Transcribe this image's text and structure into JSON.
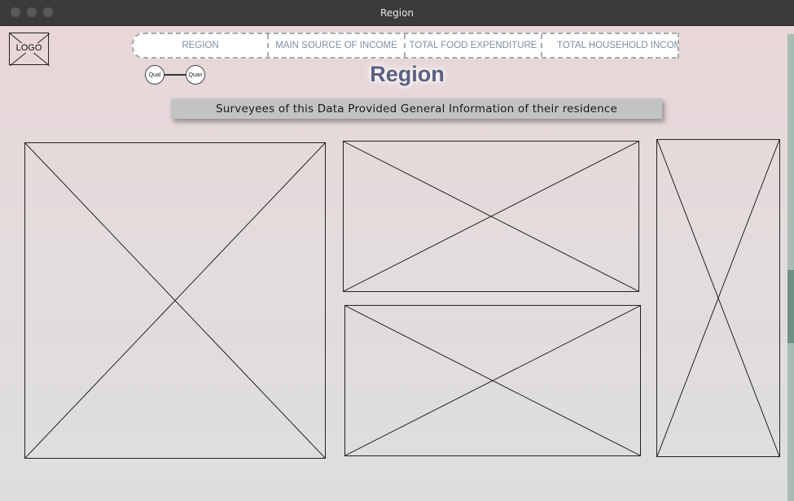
{
  "window": {
    "title": "Region"
  },
  "logo": {
    "label": "LOGO"
  },
  "tabs": [
    {
      "label": "REGION"
    },
    {
      "label": "MAIN SOURCE OF INCOME"
    },
    {
      "label": "TOTAL FOOD EXPENDITURE"
    },
    {
      "label": "TOTAL HOUSEHOLD INCOME"
    }
  ],
  "toggle": {
    "left_label": "Qual",
    "right_label": "Quan"
  },
  "page": {
    "title": "Region",
    "subtitle": "Surveyees of this Data Provided General Information of their residence"
  }
}
